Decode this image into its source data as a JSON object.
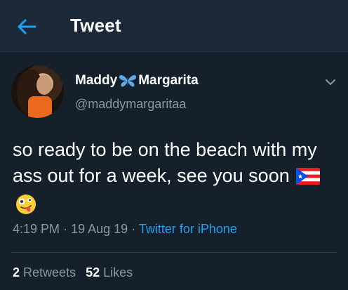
{
  "header": {
    "title": "Tweet",
    "back_icon": "arrow-left-icon",
    "accent_color": "#1da1f2",
    "background": "#1c2938"
  },
  "tweet": {
    "author": {
      "name_first": "Maddy",
      "name_emoji": "butterfly-icon",
      "name_last": "Margarita",
      "handle": "@maddymargaritaa"
    },
    "text_line": "so ready to be on the beach with my ass out for a week, see you soon",
    "text_emojis": [
      "puerto-rico-flag-icon",
      "zany-face-icon"
    ],
    "time": "4:19 PM",
    "date": "19 Aug 19",
    "separator": "·",
    "source": "Twitter for iPhone",
    "stats": {
      "retweets_count": "2",
      "retweets_label": "Retweets",
      "likes_count": "52",
      "likes_label": "Likes"
    }
  },
  "colors": {
    "page_background": "#15202b",
    "secondary_text": "#8899a6",
    "link": "#1da1f2",
    "divider": "#38444d"
  }
}
